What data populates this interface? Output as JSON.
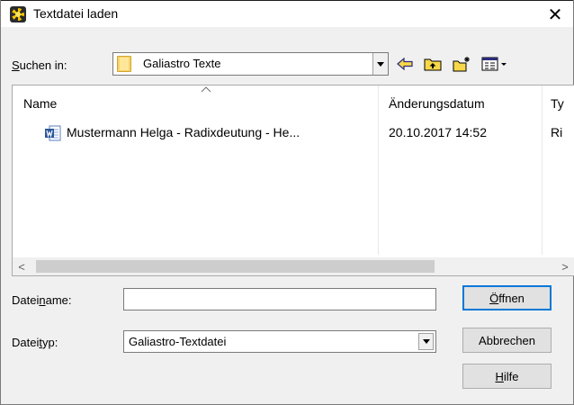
{
  "window": {
    "title": "Textdatei laden",
    "close_glyph": "✕"
  },
  "toolbar": {
    "lookin_label_pre": "",
    "lookin_label_u": "S",
    "lookin_label_post": "uchen in:",
    "lookin_value": "Galiastro Texte",
    "icons": [
      "back-arrow-icon",
      "up-folder-icon",
      "new-folder-icon",
      "view-menu-icon"
    ]
  },
  "filelist": {
    "columns": [
      "Name",
      "Änderungsdatum",
      "Ty"
    ],
    "rows": [
      {
        "name": "Mustermann Helga - Radixdeutung - He...",
        "date": "20.10.2017 14:52",
        "type": "Ri"
      }
    ],
    "scroll_left": "<",
    "scroll_right": ">"
  },
  "fields": {
    "filename_label_pre": "Datei",
    "filename_label_u": "n",
    "filename_label_post": "ame:",
    "filename_value": "",
    "filetype_label_pre": "Datei",
    "filetype_label_u": "t",
    "filetype_label_post": "yp:",
    "filetype_value": "Galiastro-Textdatei"
  },
  "buttons": {
    "open_u": "Ö",
    "open_rest": "ffnen",
    "cancel": "Abbrechen",
    "help_u": "H",
    "help_rest": "ilfe"
  },
  "colors": {
    "accent": "#0078d7",
    "dialog_bg": "#f0f0f0",
    "folder": "#f7d26a"
  }
}
